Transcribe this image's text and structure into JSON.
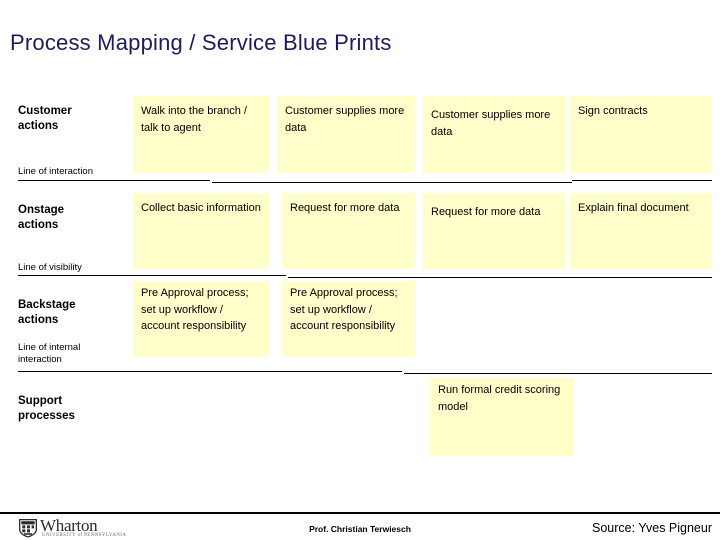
{
  "slide": {
    "title": "Process Mapping / Service Blue Prints",
    "title_color": "#1c1c5c",
    "box_color": "#ffffcc",
    "background_color": "#ffffff"
  },
  "rows": [
    {
      "id": "customer-actions",
      "label_line1": "Customer",
      "label_line2": "actions",
      "boxes": [
        {
          "text": "Walk into the branch / talk to agent"
        },
        {
          "text": "Customer supplies more data"
        },
        {
          "text": "Customer supplies more data"
        },
        {
          "text": "Sign contracts"
        }
      ]
    },
    {
      "id": "onstage-actions",
      "label_line1": "Onstage",
      "label_line2": "actions",
      "boxes": [
        {
          "text": "Collect basic information"
        },
        {
          "text": "Request for more data"
        },
        {
          "text": "Request for more data"
        },
        {
          "text": "Explain final document"
        }
      ]
    },
    {
      "id": "backstage-actions",
      "label_line1": "Backstage",
      "label_line2": "actions",
      "boxes": [
        {
          "text": "Pre Approval process; set up workflow / account responsibility"
        },
        {
          "text": "Pre Approval process; set up workflow / account responsibility"
        }
      ]
    },
    {
      "id": "support-processes",
      "label_line1": "Support",
      "label_line2": "processes",
      "boxes": [
        {
          "text": "Run formal credit scoring model"
        }
      ]
    }
  ],
  "separators": [
    {
      "id": "line-of-interaction",
      "caption": "Line of interaction"
    },
    {
      "id": "line-of-visibility",
      "caption": "Line of visibility"
    },
    {
      "id": "line-of-internal-interaction",
      "caption_line1": "Line of internal",
      "caption_line2": "interaction"
    }
  ],
  "footer": {
    "author": "Prof. Christian Terwiesch",
    "source": "Source: Yves Pigneur",
    "logo_wordmark": "Wharton",
    "logo_subtitle": "UNIVERSITY of PENNSYLVANIA"
  }
}
